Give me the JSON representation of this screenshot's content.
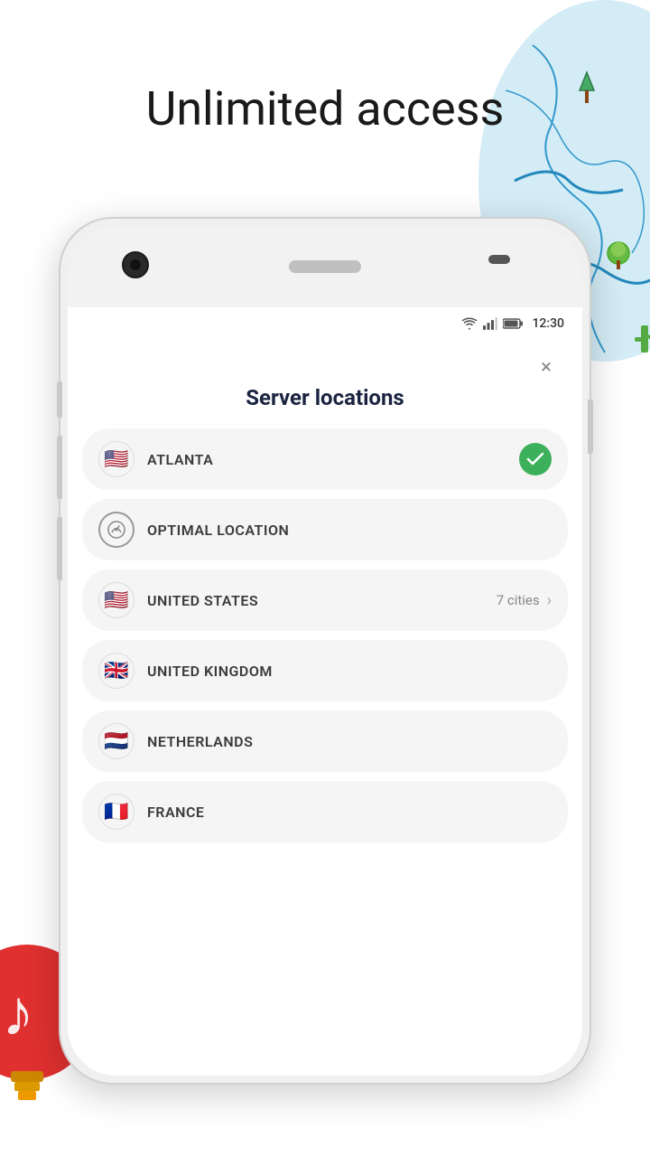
{
  "page": {
    "title": "Unlimited access"
  },
  "status_bar": {
    "time": "12:30"
  },
  "modal": {
    "title": "Server locations",
    "close_label": "×"
  },
  "locations": [
    {
      "id": "atlanta",
      "name": "ATLANTA",
      "flag": "🇺🇸",
      "selected": true,
      "cities_count": null
    },
    {
      "id": "optimal",
      "name": "OPTIMAL LOCATION",
      "flag": null,
      "selected": false,
      "cities_count": null
    },
    {
      "id": "united-states",
      "name": "UNITED STATES",
      "flag": "🇺🇸",
      "selected": false,
      "cities_count": "7 cities"
    },
    {
      "id": "united-kingdom",
      "name": "UNITED KINGDOM",
      "flag": "🇬🇧",
      "selected": false,
      "cities_count": null
    },
    {
      "id": "netherlands",
      "name": "NETHERLANDS",
      "flag": "🇳🇱",
      "selected": false,
      "cities_count": null
    },
    {
      "id": "france",
      "name": "FRANCE",
      "flag": "🇫🇷",
      "selected": false,
      "cities_count": null
    }
  ],
  "colors": {
    "selected_check": "#3db05b",
    "item_bg": "#f5f5f5",
    "title_color": "#1a2340"
  }
}
